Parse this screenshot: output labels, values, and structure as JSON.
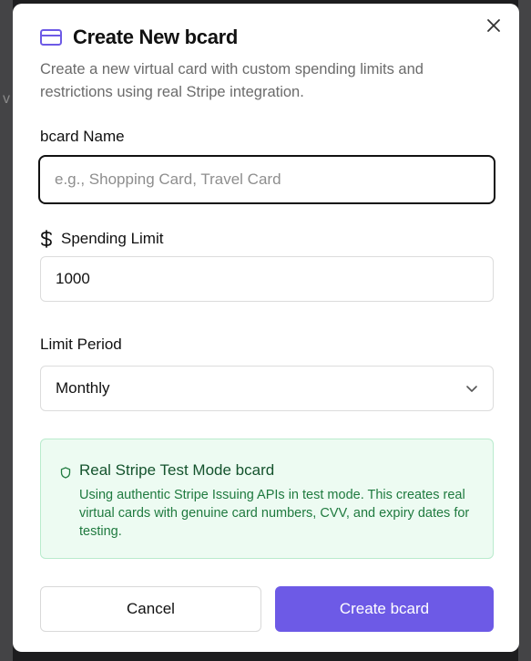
{
  "backdrop": {
    "glyph": "v"
  },
  "dialog": {
    "title": "Create New bcard",
    "subtitle": "Create a new virtual card with custom spending limits and restrictions using real Stripe integration.",
    "icons": {
      "title": "credit-card-icon",
      "close": "close-icon",
      "limit": "dollar-sign-icon",
      "select": "chevron-down-icon",
      "info": "shield-icon"
    },
    "fields": {
      "name": {
        "label": "bcard Name",
        "value": "",
        "placeholder": "e.g., Shopping Card, Travel Card"
      },
      "limit": {
        "label": "Spending Limit",
        "value": "1000"
      },
      "period": {
        "label": "Limit Period",
        "value": "Monthly"
      }
    },
    "info": {
      "title": "Real Stripe Test Mode bcard",
      "body": "Using authentic Stripe Issuing APIs in test mode. This creates real virtual cards with genuine card numbers, CVV, and expiry dates for testing."
    },
    "buttons": {
      "cancel": "Cancel",
      "create": "Create bcard"
    }
  },
  "colors": {
    "accent": "#6d5ae6",
    "info_background": "#edfbf2",
    "info_border": "#b9ebcd",
    "info_title": "#14532d",
    "info_text": "#1f7a3f"
  }
}
